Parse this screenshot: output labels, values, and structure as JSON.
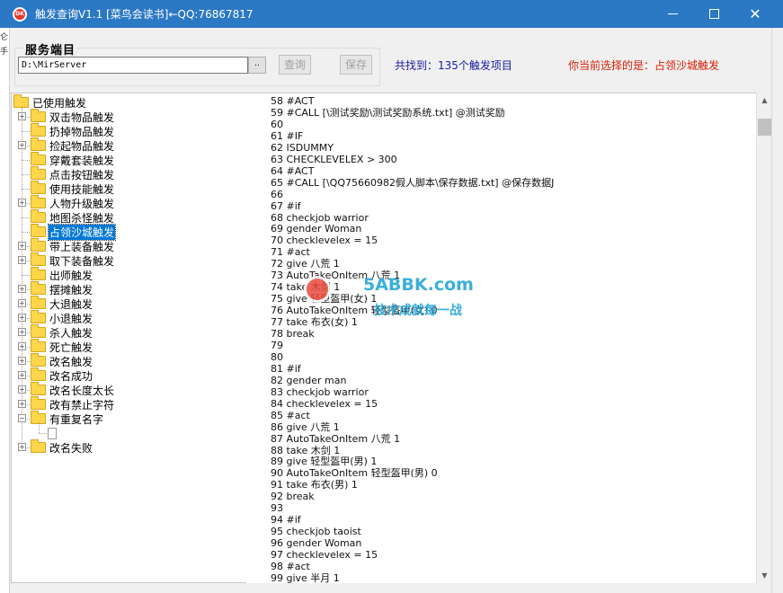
{
  "window": {
    "title": "触发查询V1.1 [菜鸟会读书]←QQ:76867817",
    "icon_text": "DK"
  },
  "server": {
    "legend": "服务端目",
    "path_value": "D:\\MirServer",
    "browse_label": "..",
    "query_label": "查询",
    "save_label": "保存"
  },
  "status": {
    "found": "共找到：135个触发项目",
    "selected": "你当前选择的是：占领沙城触发"
  },
  "tree": {
    "root": "已使用触发",
    "items": [
      {
        "label": "双击物品触发",
        "expandable": true
      },
      {
        "label": "扔掉物品触发",
        "expandable": false
      },
      {
        "label": "捡起物品触发",
        "expandable": true
      },
      {
        "label": "穿戴套装触发",
        "expandable": false
      },
      {
        "label": "点击按钮触发",
        "expandable": false
      },
      {
        "label": "使用技能触发",
        "expandable": false
      },
      {
        "label": "人物升级触发",
        "expandable": true
      },
      {
        "label": "地图杀怪触发",
        "expandable": false
      },
      {
        "label": "占领沙城触发",
        "expandable": false,
        "selected": true
      },
      {
        "label": "带上装备触发",
        "expandable": true
      },
      {
        "label": "取下装备触发",
        "expandable": true
      },
      {
        "label": "出师触发",
        "expandable": false
      },
      {
        "label": "摆摊触发",
        "expandable": true
      },
      {
        "label": "大退触发",
        "expandable": true
      },
      {
        "label": "小退触发",
        "expandable": true
      },
      {
        "label": "杀人触发",
        "expandable": true
      },
      {
        "label": "死亡触发",
        "expandable": true
      },
      {
        "label": "改名触发",
        "expandable": true
      },
      {
        "label": "改名成功",
        "expandable": true
      },
      {
        "label": "改名长度太长",
        "expandable": true
      },
      {
        "label": "改有禁止字符",
        "expandable": true
      },
      {
        "label": "有重复名字",
        "expandable": true,
        "expanded": true
      },
      {
        "label": "",
        "is_doc": true
      },
      {
        "label": "改名失败",
        "expandable": true
      }
    ]
  },
  "code_lines": [
    "58 #ACT",
    "59 #CALL [\\测试奖励\\测试奖励系统.txt] @测试奖励",
    "60",
    "61 #IF",
    "62 ISDUMMY",
    "63 CHECKLEVELEX > 300",
    "64 #ACT",
    "65 #CALL [\\QQ75660982假人脚本\\保存数据.txt] @保存数据J",
    "66",
    "67 #if",
    "68 checkjob warrior",
    "69 gender Woman",
    "70 checklevelex = 15",
    "71 #act",
    "72 give 八荒 1",
    "73 AutoTakeOnItem 八荒 1",
    "74 take 木剑 1",
    "75 give 轻型盔甲(女) 1",
    "76 AutoTakeOnItem 轻型盔甲(女) 0",
    "77 take 布衣(女) 1",
    "78 break",
    "79",
    "80",
    "81 #if",
    "82 gender man",
    "83 checkjob warrior",
    "84 checklevelex = 15",
    "85 #act",
    "86 give 八荒 1",
    "87 AutoTakeOnItem 八荒 1",
    "88 take 木剑 1",
    "89 give 轻型盔甲(男) 1",
    "90 AutoTakeOnItem 轻型盔甲(男) 0",
    "91 take 布衣(男) 1",
    "92 break",
    "93",
    "94 #if",
    "95 checkjob taoist",
    "96 gender Woman",
    "97 checklevelex = 15",
    "98 #act",
    "99 give 半月 1"
  ],
  "watermark": {
    "site": "5ABBK.com",
    "slogan": "技术成就每一战"
  },
  "background_window_chars": [
    "仑",
    "手"
  ],
  "colors": {
    "titlebar": "#2b78c5",
    "found_text": "#1a1aa6",
    "selected_text": "#d81e06",
    "selection": "#0078d7"
  }
}
